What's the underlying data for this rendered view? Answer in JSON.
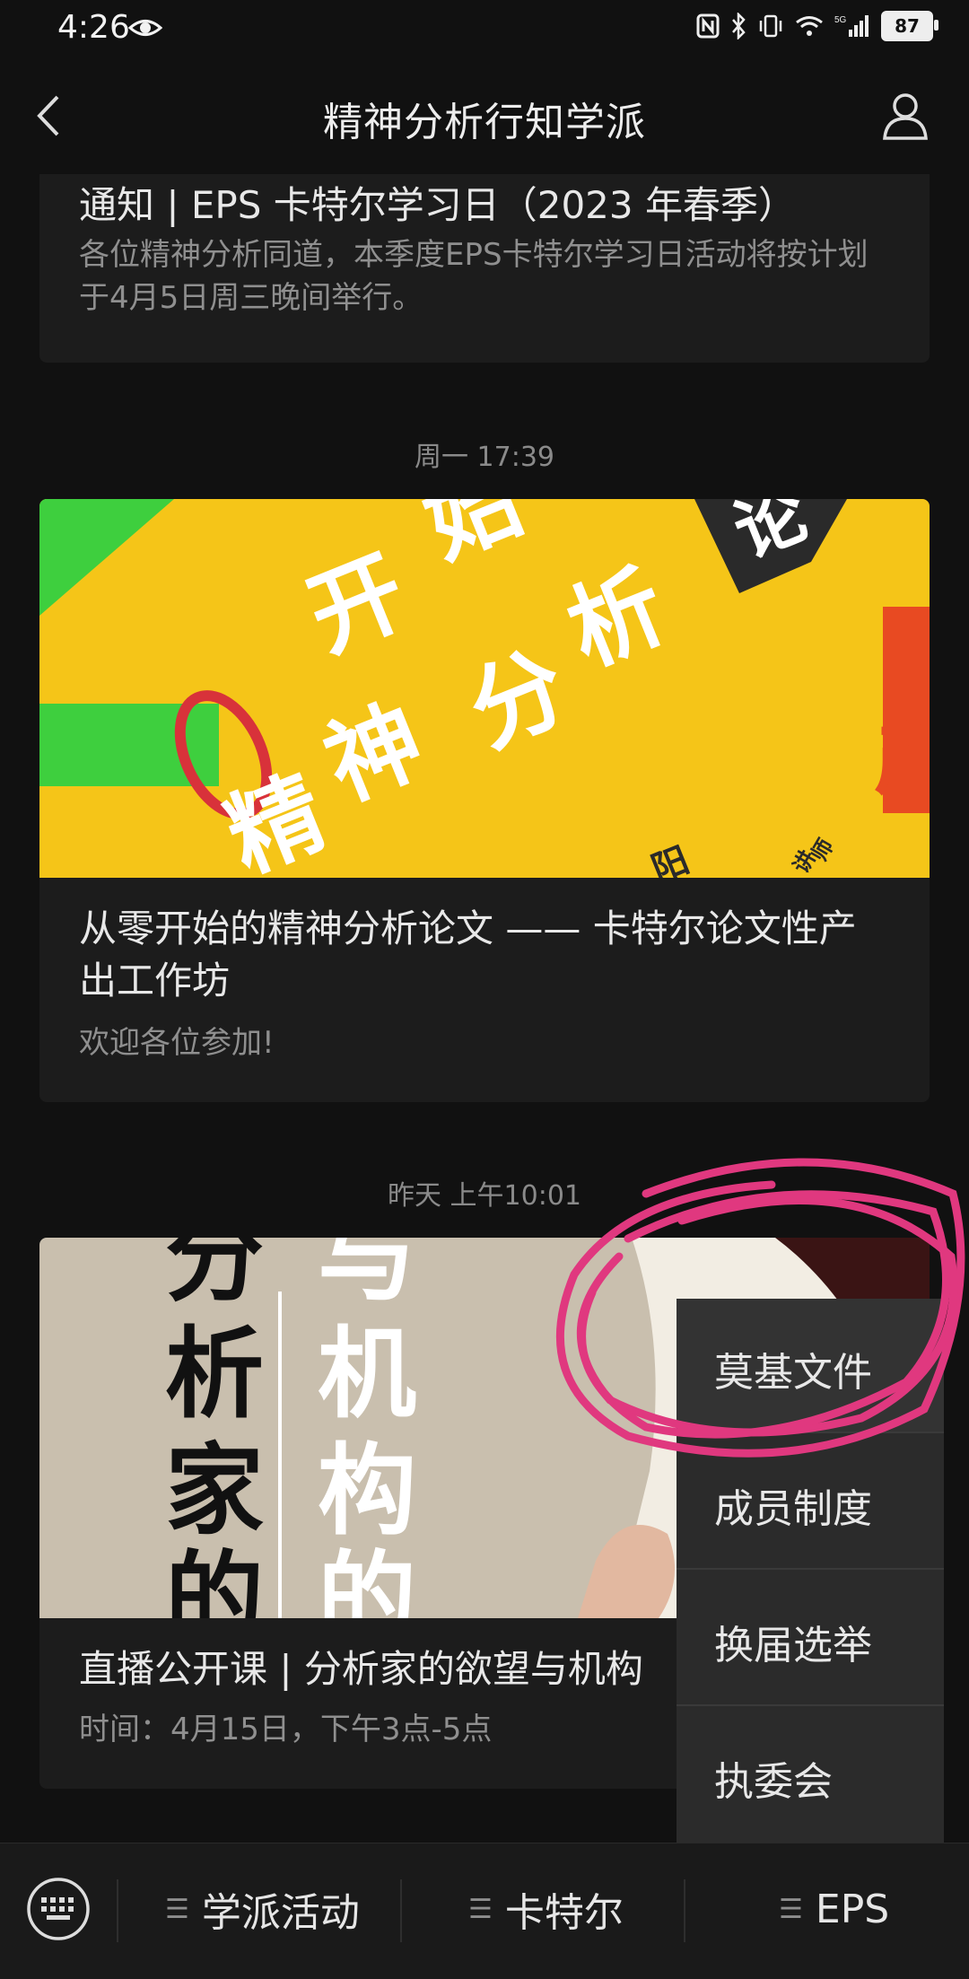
{
  "status_bar": {
    "time": "4:26",
    "battery": "87",
    "network": "5G"
  },
  "header": {
    "title": "精神分析行知学派"
  },
  "feed": {
    "card1": {
      "title": "通知 | EPS 卡特尔学习日（2023 年春季）",
      "desc": "各位精神分析同道，本季度EPS卡特尔学习日活动将按计划于4月5日周三晚间举行。"
    },
    "ts1": "周一 17:39",
    "card2": {
      "cover_text": [
        "开",
        "始",
        "精",
        "神",
        "分",
        "析",
        "论",
        "产",
        "阳",
        "讲",
        "师"
      ],
      "title": "从零开始的精神分析论文 —— 卡特尔论文性产出工作坊",
      "desc": "欢迎各位参加!"
    },
    "ts2": "昨天 上午10:01",
    "card3": {
      "cover_text": [
        "分",
        "析",
        "家",
        "的",
        "与",
        "机",
        "构",
        "的"
      ],
      "title": "直播公开课 | 分析家的欲望与机构",
      "desc": "时间：4月15日，下午3点-5点"
    }
  },
  "popup_menu": {
    "items": [
      "莫基文件",
      "成员制度",
      "换届选举",
      "执委会"
    ]
  },
  "bottom_menu": {
    "tabs": [
      "学派活动",
      "卡特尔",
      "EPS"
    ]
  },
  "colors": {
    "background": "#111111",
    "card": "#1c1c1c",
    "menu": "#2b2b2b",
    "annotation": "#e0387f",
    "cover_yellow": "#f5c518",
    "cover_green": "#3ecf3e"
  }
}
